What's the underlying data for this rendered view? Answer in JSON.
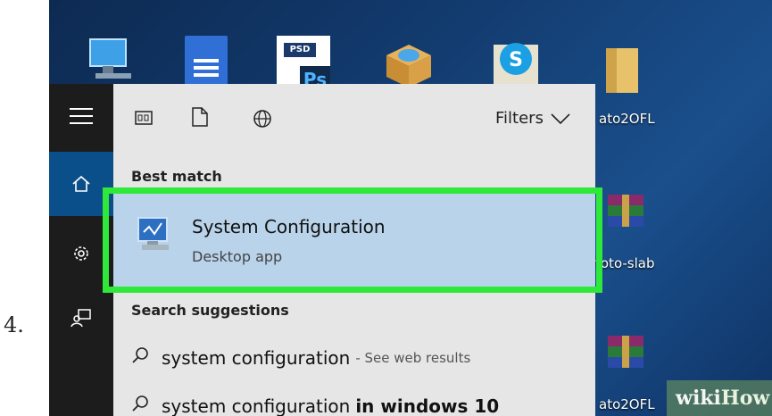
{
  "step_number": "4.",
  "desktop": {
    "psd_tag": "PSD",
    "ps_label": "Ps",
    "labels": [
      "ato2OFL",
      "toto-slab",
      "ato2OFL"
    ]
  },
  "filter_bar": {
    "filters_label": "Filters"
  },
  "best_match": {
    "heading": "Best match",
    "title": "System Configuration",
    "subtitle": "Desktop app"
  },
  "suggestions": {
    "heading": "Search suggestions",
    "items": [
      {
        "text": "system configuration",
        "suffix": "- See web results",
        "bold": ""
      },
      {
        "text": "system configuration",
        "suffix": "",
        "bold": "in windows 10"
      }
    ]
  },
  "watermark": {
    "wiki": "wiki",
    "how": "How"
  },
  "colors": {
    "highlight": "#2ee83a",
    "selected_bg": "#b9d3ea",
    "panel_bg": "#e6e6e6",
    "rail_bg": "#1c1c1c",
    "rail_active": "#0b4f8a"
  }
}
